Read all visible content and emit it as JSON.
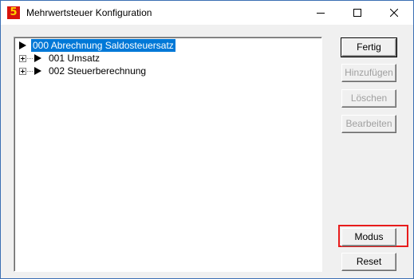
{
  "window": {
    "title": "Mehrwertsteuer Konfiguration",
    "app_icon_text": "5",
    "controls": [
      "minimize",
      "maximize",
      "close"
    ]
  },
  "tree": {
    "items": [
      {
        "label": "000 Abrechnung Saldosteuersatz",
        "selected": true,
        "expandable": false
      },
      {
        "label": "001 Umsatz",
        "selected": false,
        "expandable": true
      },
      {
        "label": "002 Steuerberechnung",
        "selected": false,
        "expandable": true
      }
    ]
  },
  "buttons": {
    "fertig": {
      "label": "Fertig",
      "enabled": true
    },
    "hinzufuegen": {
      "label": "Hinzufügen",
      "enabled": false
    },
    "loeschen": {
      "label": "Löschen",
      "enabled": false
    },
    "bearbeiten": {
      "label": "Bearbeiten",
      "enabled": false
    },
    "modus": {
      "label": "Modus",
      "enabled": true
    },
    "reset": {
      "label": "Reset",
      "enabled": true
    }
  },
  "colors": {
    "selection": "#0078d7",
    "highlight_box": "#e81c1c",
    "app_icon_bg": "#d8140c",
    "app_icon_fg": "#ffd200"
  }
}
